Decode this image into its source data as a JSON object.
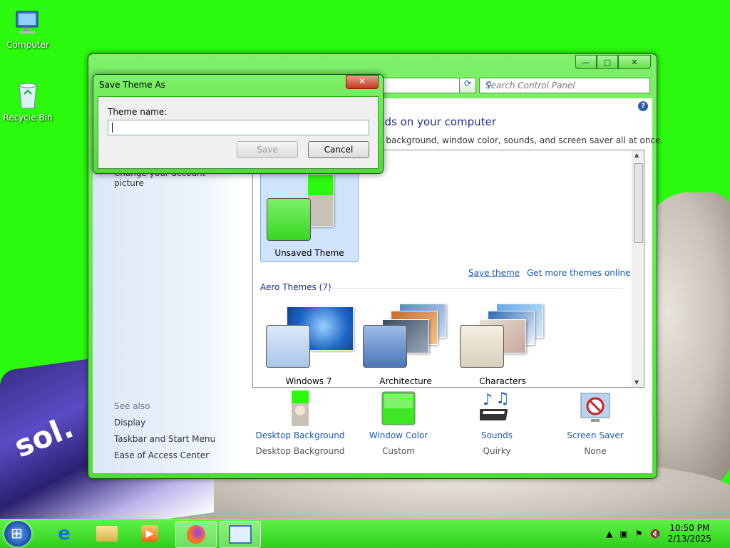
{
  "desktop": {
    "icons": [
      {
        "label": "Computer"
      },
      {
        "label": "Recycle Bin"
      }
    ],
    "bottle_text": "sol."
  },
  "window": {
    "search_placeholder": "Search Control Panel",
    "heading": "nds on your computer",
    "subheading": "p background, window color, sounds, and screen saver all at once.",
    "sidepane": {
      "link_account": "Change your account picture",
      "see_also": "See also",
      "links": [
        "Display",
        "Taskbar and Start Menu",
        "Ease of Access Center"
      ]
    },
    "themes": {
      "my_theme": "Unsaved Theme",
      "save_theme": "Save theme",
      "get_more": "Get more themes online",
      "aero_title": "Aero Themes (7)",
      "aero": [
        "Windows 7",
        "Architecture",
        "Characters"
      ]
    },
    "bottom": [
      {
        "title": "Desktop Background",
        "value": "Desktop Background"
      },
      {
        "title": "Window Color",
        "value": "Custom"
      },
      {
        "title": "Sounds",
        "value": "Quirky"
      },
      {
        "title": "Screen Saver",
        "value": "None"
      }
    ]
  },
  "dialog": {
    "title": "Save Theme As",
    "label": "Theme name:",
    "input_value": "",
    "save": "Save",
    "cancel": "Cancel"
  },
  "taskbar": {
    "time": "10:50 PM",
    "date": "2/13/2025"
  },
  "colors": {
    "accent_green": "#2bf90d",
    "link_blue": "#1e59b4",
    "heading_blue": "#1e3287"
  }
}
